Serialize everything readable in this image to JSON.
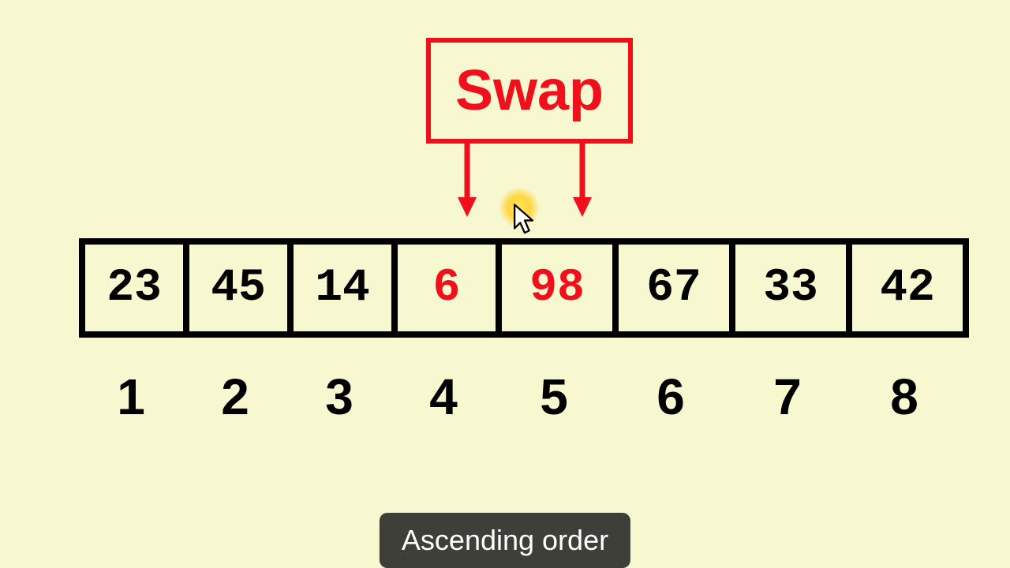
{
  "swap_label": "Swap",
  "array": {
    "cells": [
      {
        "value": "23",
        "highlighted": false
      },
      {
        "value": "45",
        "highlighted": false
      },
      {
        "value": "14",
        "highlighted": false
      },
      {
        "value": "6",
        "highlighted": true
      },
      {
        "value": "98",
        "highlighted": true
      },
      {
        "value": "67",
        "highlighted": false
      },
      {
        "value": "33",
        "highlighted": false
      },
      {
        "value": "42",
        "highlighted": false
      }
    ],
    "indices": [
      "1",
      "2",
      "3",
      "4",
      "5",
      "6",
      "7",
      "8"
    ]
  },
  "caption": "Ascending order",
  "colors": {
    "accent": "#f00f1a",
    "bg": "#f7f8d0",
    "caption_bg": "#3f3f3a"
  }
}
